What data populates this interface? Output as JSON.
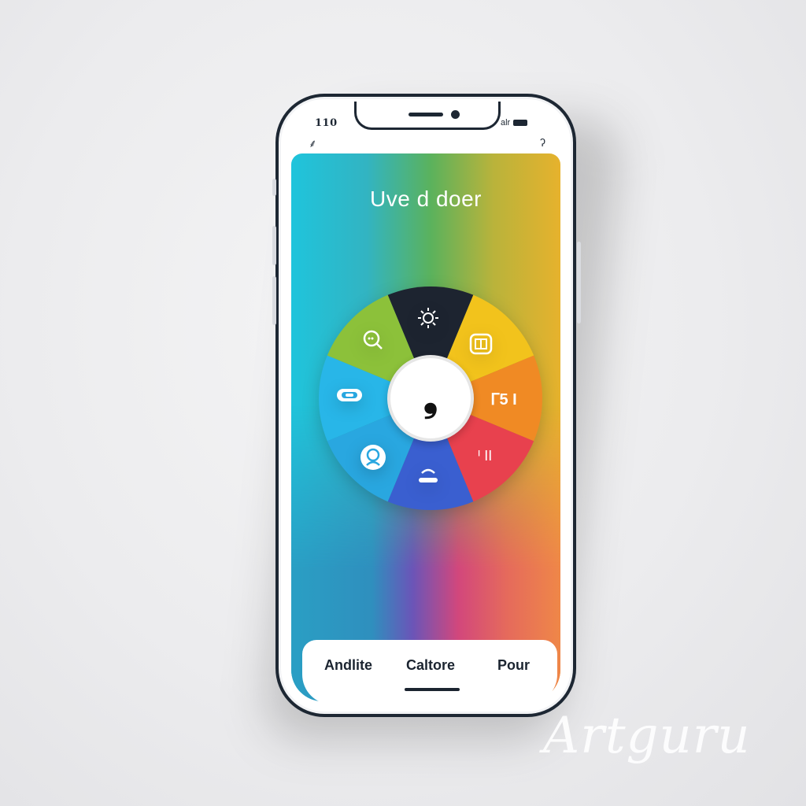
{
  "status_bar": {
    "left_text": "110",
    "right_text": "alr"
  },
  "screen": {
    "title": "Uve d doer"
  },
  "wheel": {
    "center_glyph": "❟",
    "segments": [
      {
        "name": "search",
        "color": "#1d2430",
        "icon": "search-chat-icon"
      },
      {
        "name": "sun",
        "color": "#f2c31c",
        "icon": "sun-icon"
      },
      {
        "name": "calendar",
        "color": "#f08a24",
        "icon": "calendar-icon"
      },
      {
        "name": "text",
        "color": "#e8414e",
        "icon": "text-icon",
        "label": "ᒥ5 I"
      },
      {
        "name": "chart",
        "color": "#3a5fd0",
        "icon": "chart-icon",
        "label": "ᑊ II"
      },
      {
        "name": "phone",
        "color": "#29a7e0",
        "icon": "phone-icon"
      },
      {
        "name": "person",
        "color": "#28b6e8",
        "icon": "person-icon"
      },
      {
        "name": "battery",
        "color": "#8cc13a",
        "icon": "battery-icon"
      }
    ]
  },
  "tabbar": {
    "tabs": [
      "Andlite",
      "Caltore",
      "Pour"
    ]
  },
  "watermark": "Artguru"
}
